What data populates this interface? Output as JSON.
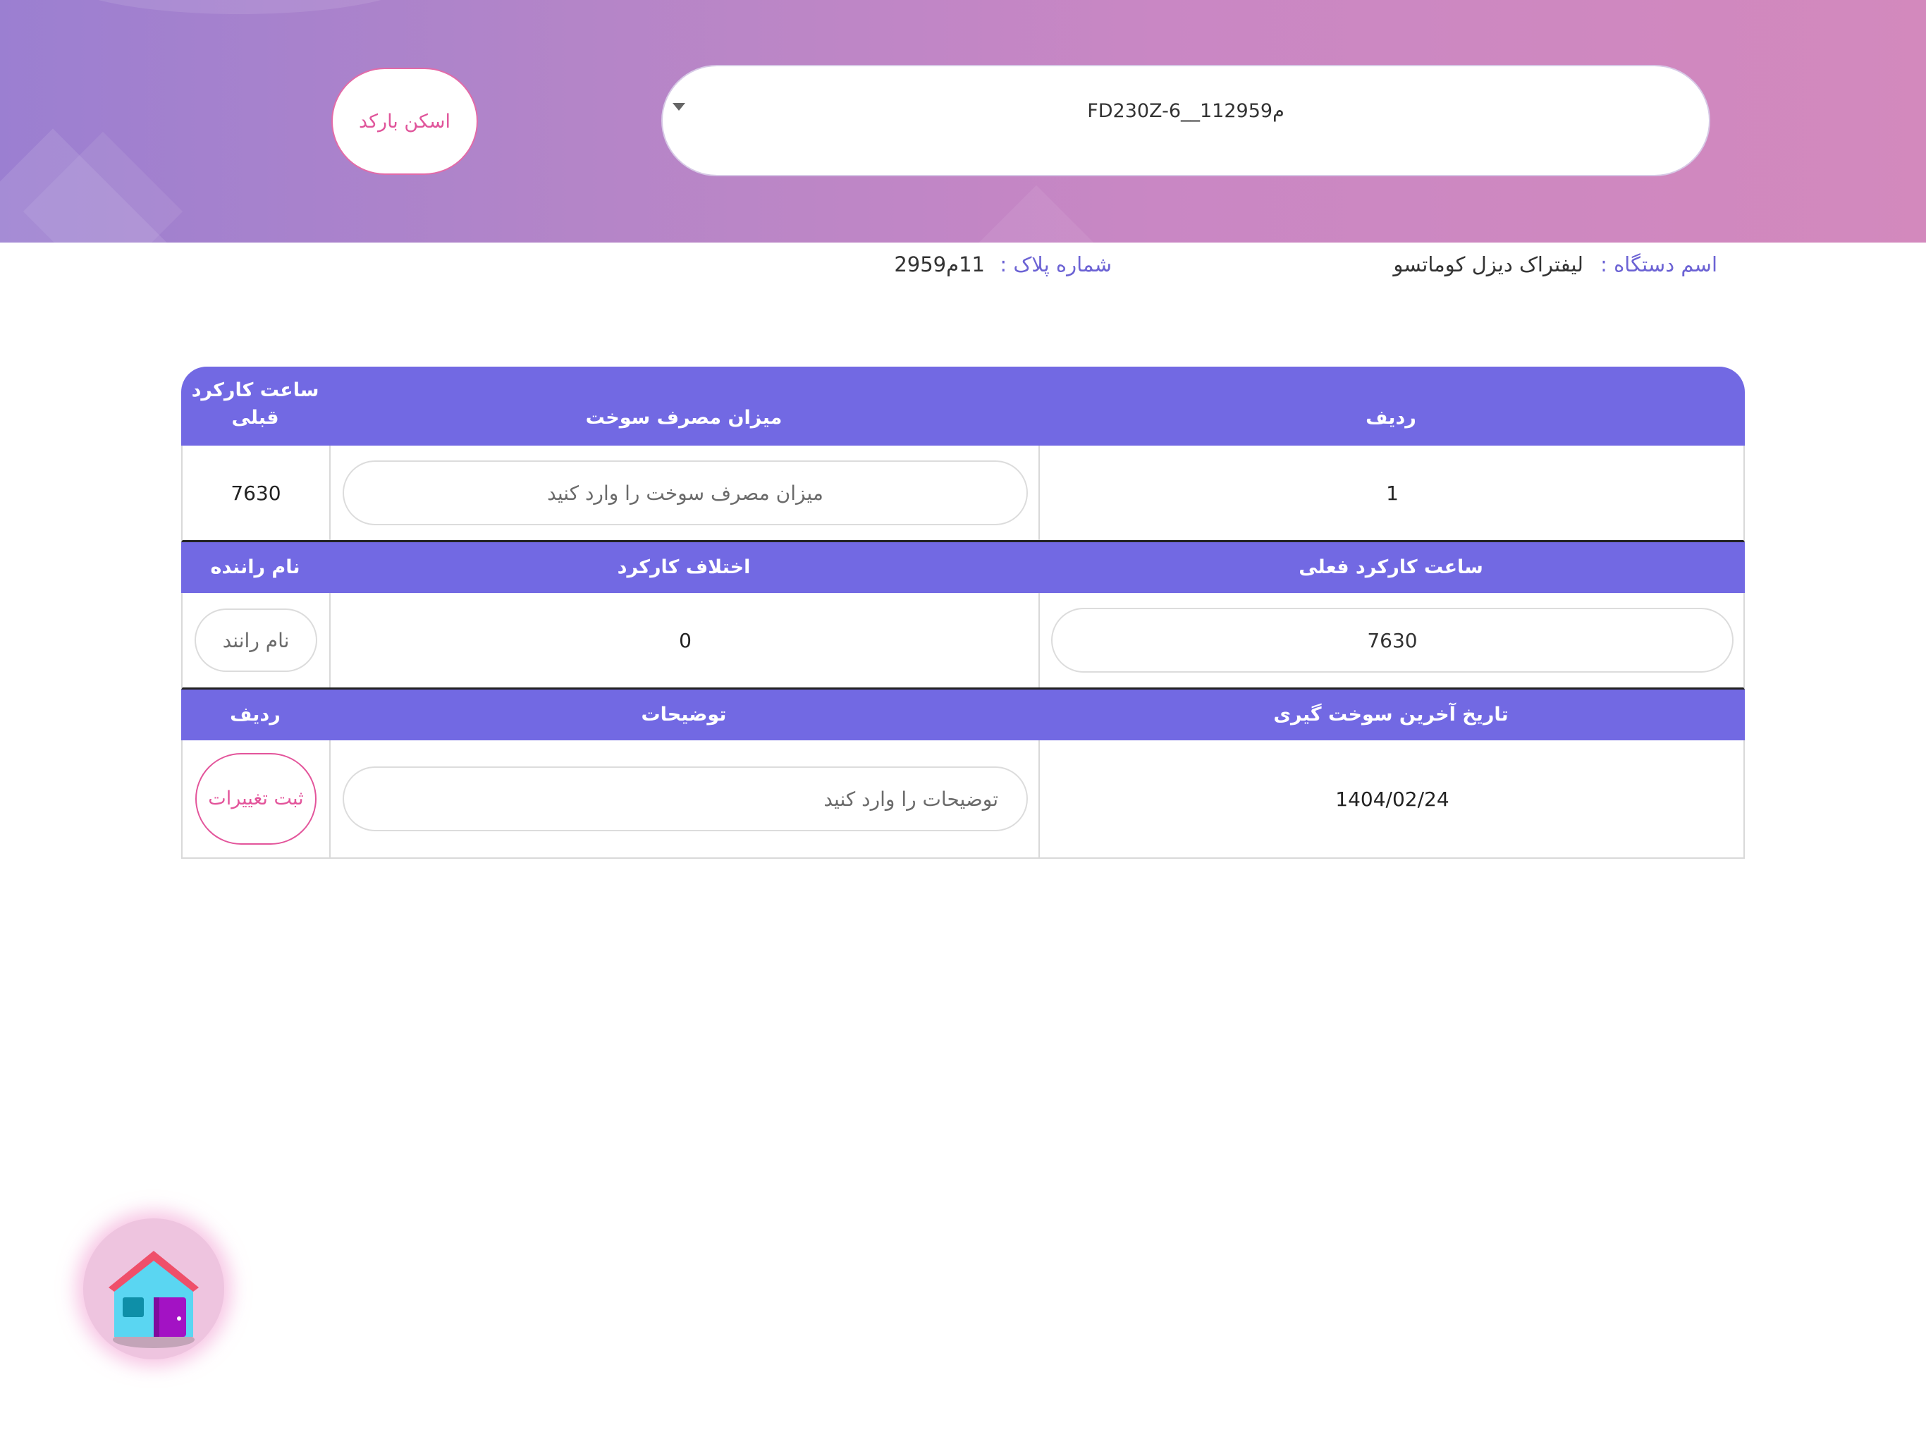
{
  "header": {
    "device_select": {
      "value": "FD230Z-6__11م2959"
    },
    "scan_button_label": "اسکن بارکد"
  },
  "info": {
    "device_name_label": "اسم دستگاه :",
    "device_name_value": "لیفتراک دیزل کوماتسو",
    "plate_label": "شماره پلاک :",
    "plate_value": "11م2959"
  },
  "table": {
    "section1": {
      "headers": [
        "ردیف",
        "میزان مصرف سوخت",
        "ساعت کارکرد قبلی"
      ],
      "row_number": "1",
      "fuel_placeholder": "میزان مصرف سوخت را وارد کنید",
      "previous_hours": "7630"
    },
    "section2": {
      "headers": [
        "ساعت کارکرد فعلی",
        "اختلاف کارکرد",
        "نام راننده"
      ],
      "current_hours": "7630",
      "difference": "0",
      "driver_placeholder": "نام رانند"
    },
    "section3": {
      "headers": [
        "تاریخ آخرین سوخت گیری",
        "توضیحات",
        "ردیف"
      ],
      "last_fuel_date": "1404/02/24",
      "notes_placeholder": "توضیحات را وارد کنید",
      "save_label": "ثبت تغییرات"
    }
  },
  "colors": {
    "header_gradient_start": "#9b7fd1",
    "header_gradient_end": "#d389bd",
    "table_header": "#7269e3",
    "accent_pink": "#e3559b",
    "label_purple": "#6c63d4"
  },
  "icons": {
    "home": "home-icon",
    "caret": "chevron-down-icon"
  }
}
